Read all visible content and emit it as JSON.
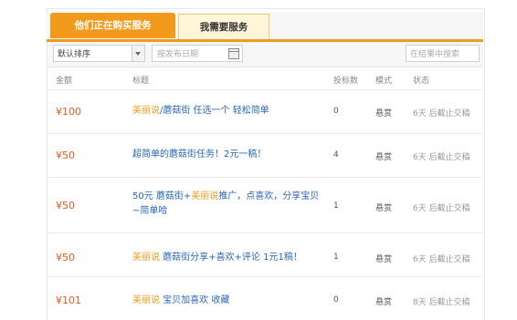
{
  "tabs": {
    "active": "他们正在购买服务",
    "inactive": "我需要服务"
  },
  "filters": {
    "sort_value": "默认排序",
    "date_placeholder": "按发布日期",
    "search_placeholder": "在结果中搜索"
  },
  "table": {
    "columns": [
      "金额",
      "标题",
      "投标数",
      "模式",
      "状态"
    ],
    "rows": [
      {
        "amount": "¥100",
        "title_hl": "美丽说",
        "title_rest": "/蘑菇街 任选一个 轻松简单",
        "bids": "0",
        "mode": "悬赏",
        "status": "6天 后截止交稿"
      },
      {
        "amount": "¥50",
        "title_hl": "",
        "title_rest": "超简单的蘑菇街任务！2元一稿！",
        "bids": "4",
        "mode": "悬赏",
        "status": "6天 后截止交稿"
      },
      {
        "amount": "¥50",
        "title_pre": "50元 蘑菇街+",
        "title_hl": "美丽说",
        "title_rest": "推广，点喜欢，分享宝贝~简单哈",
        "bids": "1",
        "mode": "悬赏",
        "status": "6天 后截止交稿"
      },
      {
        "amount": "¥50",
        "title_hl": "美丽说",
        "title_rest": " 蘑菇街分享+喜欢+评论 1元1稿！",
        "bids": "1",
        "mode": "悬赏",
        "status": "6天 后截止交稿"
      },
      {
        "amount": "¥101",
        "title_hl": "美丽说",
        "title_rest": " 宝贝加喜欢 收藏",
        "bids": "0",
        "mode": "悬赏",
        "status": "8天 后截止交稿"
      }
    ]
  }
}
